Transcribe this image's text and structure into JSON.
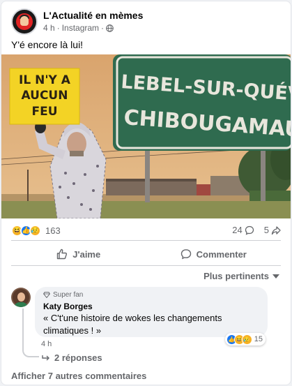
{
  "post": {
    "page_name": "L'Actualité en mèmes",
    "time": "4 h",
    "source": "Instagram",
    "separator": "·",
    "caption": "Y'é encore là lui!"
  },
  "image": {
    "protest_sign": [
      "IL N'Y A",
      "AUCUN",
      "FEU"
    ],
    "road_sign": [
      "LEBEL-SUR-QUÉVILLON",
      "CHIBOUGAMAU"
    ]
  },
  "engagement": {
    "reaction_count": "163",
    "comment_count": "24",
    "share_count": "5"
  },
  "actions": {
    "like_label": "J'aime",
    "comment_label": "Commenter"
  },
  "sort": {
    "label": "Plus pertinents"
  },
  "comment": {
    "badge": "Super fan",
    "author": "Katy Borges",
    "text": "« C't'une histoire de wokes les changements climatiques ! »",
    "time": "4 h",
    "reaction_count": "15",
    "replies_label": "2 réponses"
  },
  "more_comments": "Afficher 7 autres commentaires",
  "colors": {
    "like_blue": "#1877f2",
    "reaction_yellow": "#f7b125",
    "secondary_text": "#65676b",
    "road_sign_green": "#2f6b4f"
  }
}
